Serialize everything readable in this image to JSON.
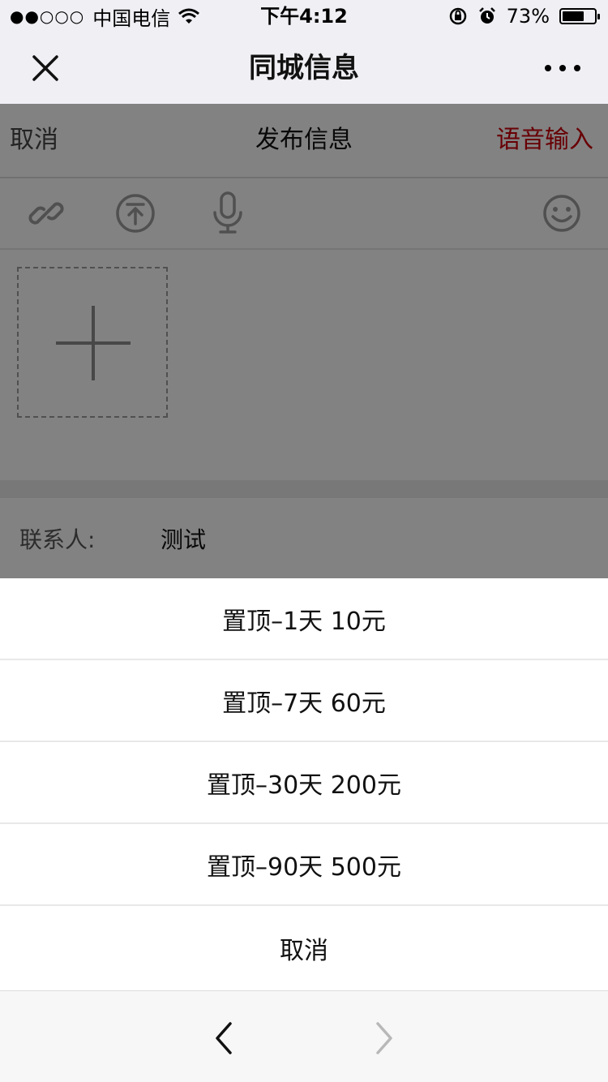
{
  "status_bar": {
    "signal": "●●○○○",
    "carrier": "中国电信",
    "time": "下午4:12",
    "battery_text": "73%",
    "battery_level": 0.73
  },
  "nav": {
    "title": "同城信息",
    "close_icon": "close-icon",
    "more_icon": "more-icon"
  },
  "publish": {
    "cancel": "取消",
    "title": "发布信息",
    "voice_input": "语音输入",
    "voice_color": "#c8000a"
  },
  "toolbar_icons": [
    "link-icon",
    "pin-top-icon",
    "microphone-icon",
    "emoji-icon"
  ],
  "contact": {
    "label": "联系人:",
    "value": "测试"
  },
  "action_sheet": {
    "options": [
      {
        "label": "置顶–1天 10元"
      },
      {
        "label": "置顶–7天 60元"
      },
      {
        "label": "置顶–30天 200元"
      },
      {
        "label": "置顶–90天 500元"
      }
    ],
    "cancel": "取消"
  },
  "browser_toolbar": {
    "back_icon": "chevron-left-icon",
    "forward_icon": "chevron-right-icon"
  }
}
